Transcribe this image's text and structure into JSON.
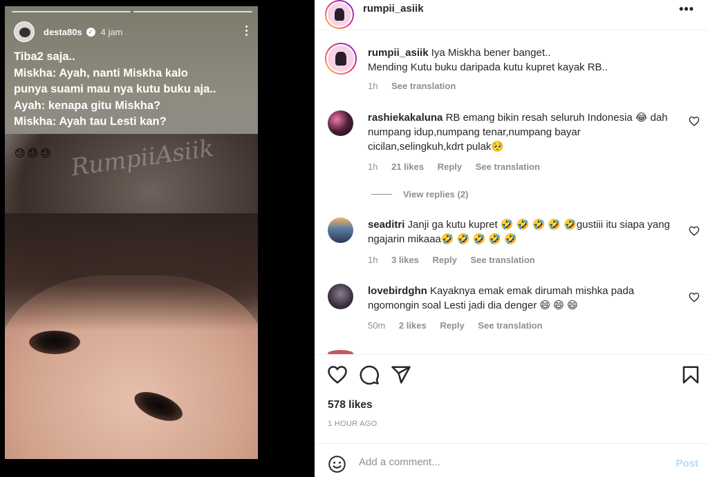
{
  "story": {
    "username": "desta80s",
    "time": "4 jam",
    "lines": [
      "Tiba2 saja..",
      "Miskha: Ayah, nanti Miskha kalo",
      "punya suami mau nya kutu buku aja..",
      "Ayah: kenapa gitu Miskha?",
      "Miskha: Ayah tau Lesti kan?"
    ],
    "emojis": "😓😓😓",
    "watermark": "RumpiiAsiik"
  },
  "post": {
    "account": "rumpii_asiik",
    "more_icon": "•••",
    "caption": {
      "username": "rumpii_asiik",
      "line1": "Iya Miskha bener banget..",
      "line2": "Mending Kutu buku daripada kutu kupret kayak RB..",
      "time": "1h",
      "translate": "See translation"
    },
    "comments": [
      {
        "username": "rashiekakaluna",
        "text": "RB emang bikin resah seluruh Indonesia 😂 dah numpang idup,numpang tenar,numpang bayar cicilan,selingkuh,kdrt pulak🥺",
        "time": "1h",
        "likes": "21 likes",
        "reply": "Reply",
        "translate": "See translation"
      },
      {
        "username": "seaditri",
        "text": "Janji ga kutu kupret 🤣 🤣 🤣 🤣 🤣gustiii itu siapa yang ngajarin mikaaa🤣 🤣 🤣 🤣 🤣",
        "time": "1h",
        "likes": "3 likes",
        "reply": "Reply",
        "translate": "See translation"
      },
      {
        "username": "lovebirdghn",
        "text": "Kayaknya emak emak dirumah mishka pada ngomongin soal Lesti jadi dia denger 😄 😄 😄",
        "time": "50m",
        "likes": "2 likes",
        "reply": "Reply",
        "translate": "See translation"
      }
    ],
    "view_replies": "View replies (2)",
    "likes_count": "578 likes",
    "posted_ago": "1 HOUR AGO",
    "add_comment": {
      "placeholder": "Add a comment...",
      "post_label": "Post"
    }
  },
  "colors": {
    "text": "#262626",
    "muted": "#8e8e8e",
    "post_disabled": "#b3dbff",
    "divider": "#efefef"
  },
  "icons": [
    "heart-icon",
    "comment-icon",
    "share-icon",
    "bookmark-icon",
    "emoji-icon",
    "verified-icon",
    "more-icon"
  ]
}
